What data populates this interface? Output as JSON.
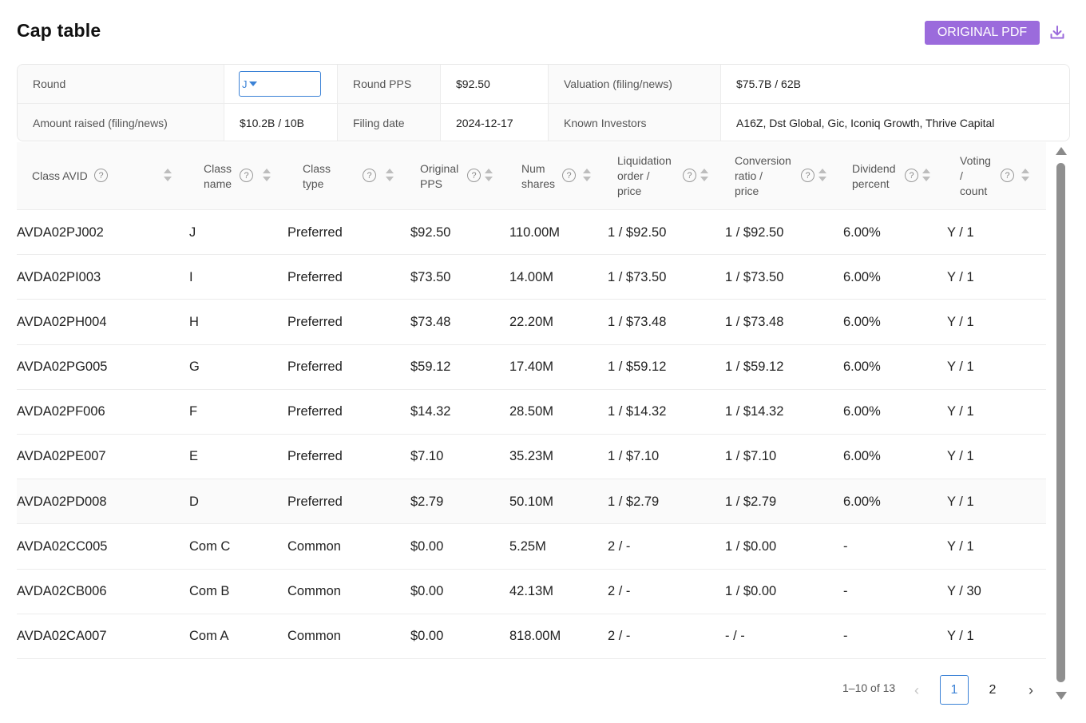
{
  "header": {
    "title": "Cap table",
    "pdf_button": "ORIGINAL PDF",
    "accent_color": "#9b6bdc"
  },
  "summary": {
    "round_label": "Round",
    "round_value": "J",
    "round_pps_label": "Round PPS",
    "round_pps_value": "$92.50",
    "valuation_label": "Valuation (filing/news)",
    "valuation_value": "$75.7B / 62B",
    "amount_label": "Amount raised (filing/news)",
    "amount_value": "$10.2B / 10B",
    "filing_date_label": "Filing date",
    "filing_date_value": "2024-12-17",
    "investors_label": "Known Investors",
    "investors_value": "A16Z, Dst Global, Gic, Iconiq Growth, Thrive Capital"
  },
  "table": {
    "columns": [
      "Class AVID",
      "Class\nname",
      "Class\ntype",
      "Original\nPPS",
      "Num\nshares",
      "Liquidation\norder /\nprice",
      "Conversion\nratio /\nprice",
      "Dividend\npercent",
      "Voting\n/\ncount"
    ],
    "rows": [
      [
        "AVDA02PJ002",
        "J",
        "Preferred",
        "$92.50",
        "110.00M",
        "1 / $92.50",
        "1 / $92.50",
        "6.00%",
        "Y / 1"
      ],
      [
        "AVDA02PI003",
        "I",
        "Preferred",
        "$73.50",
        "14.00M",
        "1 / $73.50",
        "1 / $73.50",
        "6.00%",
        "Y / 1"
      ],
      [
        "AVDA02PH004",
        "H",
        "Preferred",
        "$73.48",
        "22.20M",
        "1 / $73.48",
        "1 / $73.48",
        "6.00%",
        "Y / 1"
      ],
      [
        "AVDA02PG005",
        "G",
        "Preferred",
        "$59.12",
        "17.40M",
        "1 / $59.12",
        "1 / $59.12",
        "6.00%",
        "Y / 1"
      ],
      [
        "AVDA02PF006",
        "F",
        "Preferred",
        "$14.32",
        "28.50M",
        "1 / $14.32",
        "1 / $14.32",
        "6.00%",
        "Y / 1"
      ],
      [
        "AVDA02PE007",
        "E",
        "Preferred",
        "$7.10",
        "35.23M",
        "1 / $7.10",
        "1 / $7.10",
        "6.00%",
        "Y / 1"
      ],
      [
        "AVDA02PD008",
        "D",
        "Preferred",
        "$2.79",
        "50.10M",
        "1 / $2.79",
        "1 / $2.79",
        "6.00%",
        "Y / 1"
      ],
      [
        "AVDA02CC005",
        "Com C",
        "Common",
        "$0.00",
        "5.25M",
        "2 / -",
        "1 / $0.00",
        "-",
        "Y / 1"
      ],
      [
        "AVDA02CB006",
        "Com B",
        "Common",
        "$0.00",
        "42.13M",
        "2 / -",
        "1 / $0.00",
        "-",
        "Y / 30"
      ],
      [
        "AVDA02CA007",
        "Com A",
        "Common",
        "$0.00",
        "818.00M",
        "2 / -",
        "- / -",
        "-",
        "Y / 1"
      ]
    ]
  },
  "pagination": {
    "range_text": "1–10 of 13",
    "pages": [
      "1",
      "2"
    ],
    "current_page": "1"
  }
}
